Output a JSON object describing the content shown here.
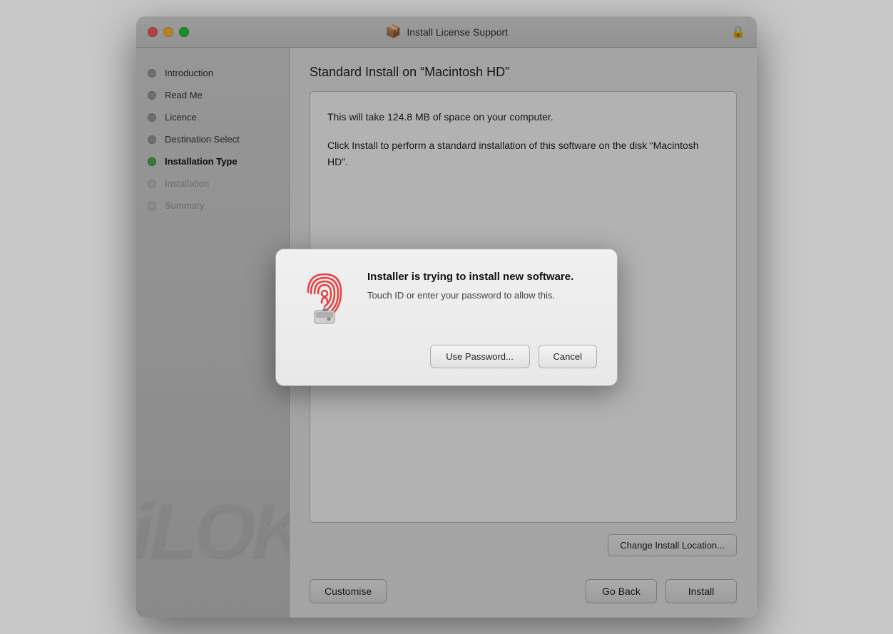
{
  "window": {
    "title": "Install License Support",
    "title_icon": "📦"
  },
  "sidebar": {
    "items": [
      {
        "id": "introduction",
        "label": "Introduction",
        "state": "inactive"
      },
      {
        "id": "read-me",
        "label": "Read Me",
        "state": "inactive"
      },
      {
        "id": "licence",
        "label": "Licence",
        "state": "inactive"
      },
      {
        "id": "destination-select",
        "label": "Destination Select",
        "state": "inactive"
      },
      {
        "id": "installation-type",
        "label": "Installation Type",
        "state": "active"
      },
      {
        "id": "installation",
        "label": "Installation",
        "state": "dim"
      },
      {
        "id": "summary",
        "label": "Summary",
        "state": "dim"
      }
    ],
    "bg_text": "iLOK"
  },
  "main": {
    "title": "Standard Install on “Macintosh HD”",
    "install_box_line1": "This will take 124.8 MB of space on your computer.",
    "install_box_line2": "Click Install to perform a standard installation of this software on the disk “Macintosh HD”.",
    "change_location_label": "Change Install Location...",
    "customise_label": "Customise",
    "go_back_label": "Go Back",
    "install_label": "Install"
  },
  "modal": {
    "title": "Installer is trying to install new software.",
    "subtitle": "Touch ID or enter your password to allow this.",
    "use_password_label": "Use Password...",
    "cancel_label": "Cancel"
  }
}
